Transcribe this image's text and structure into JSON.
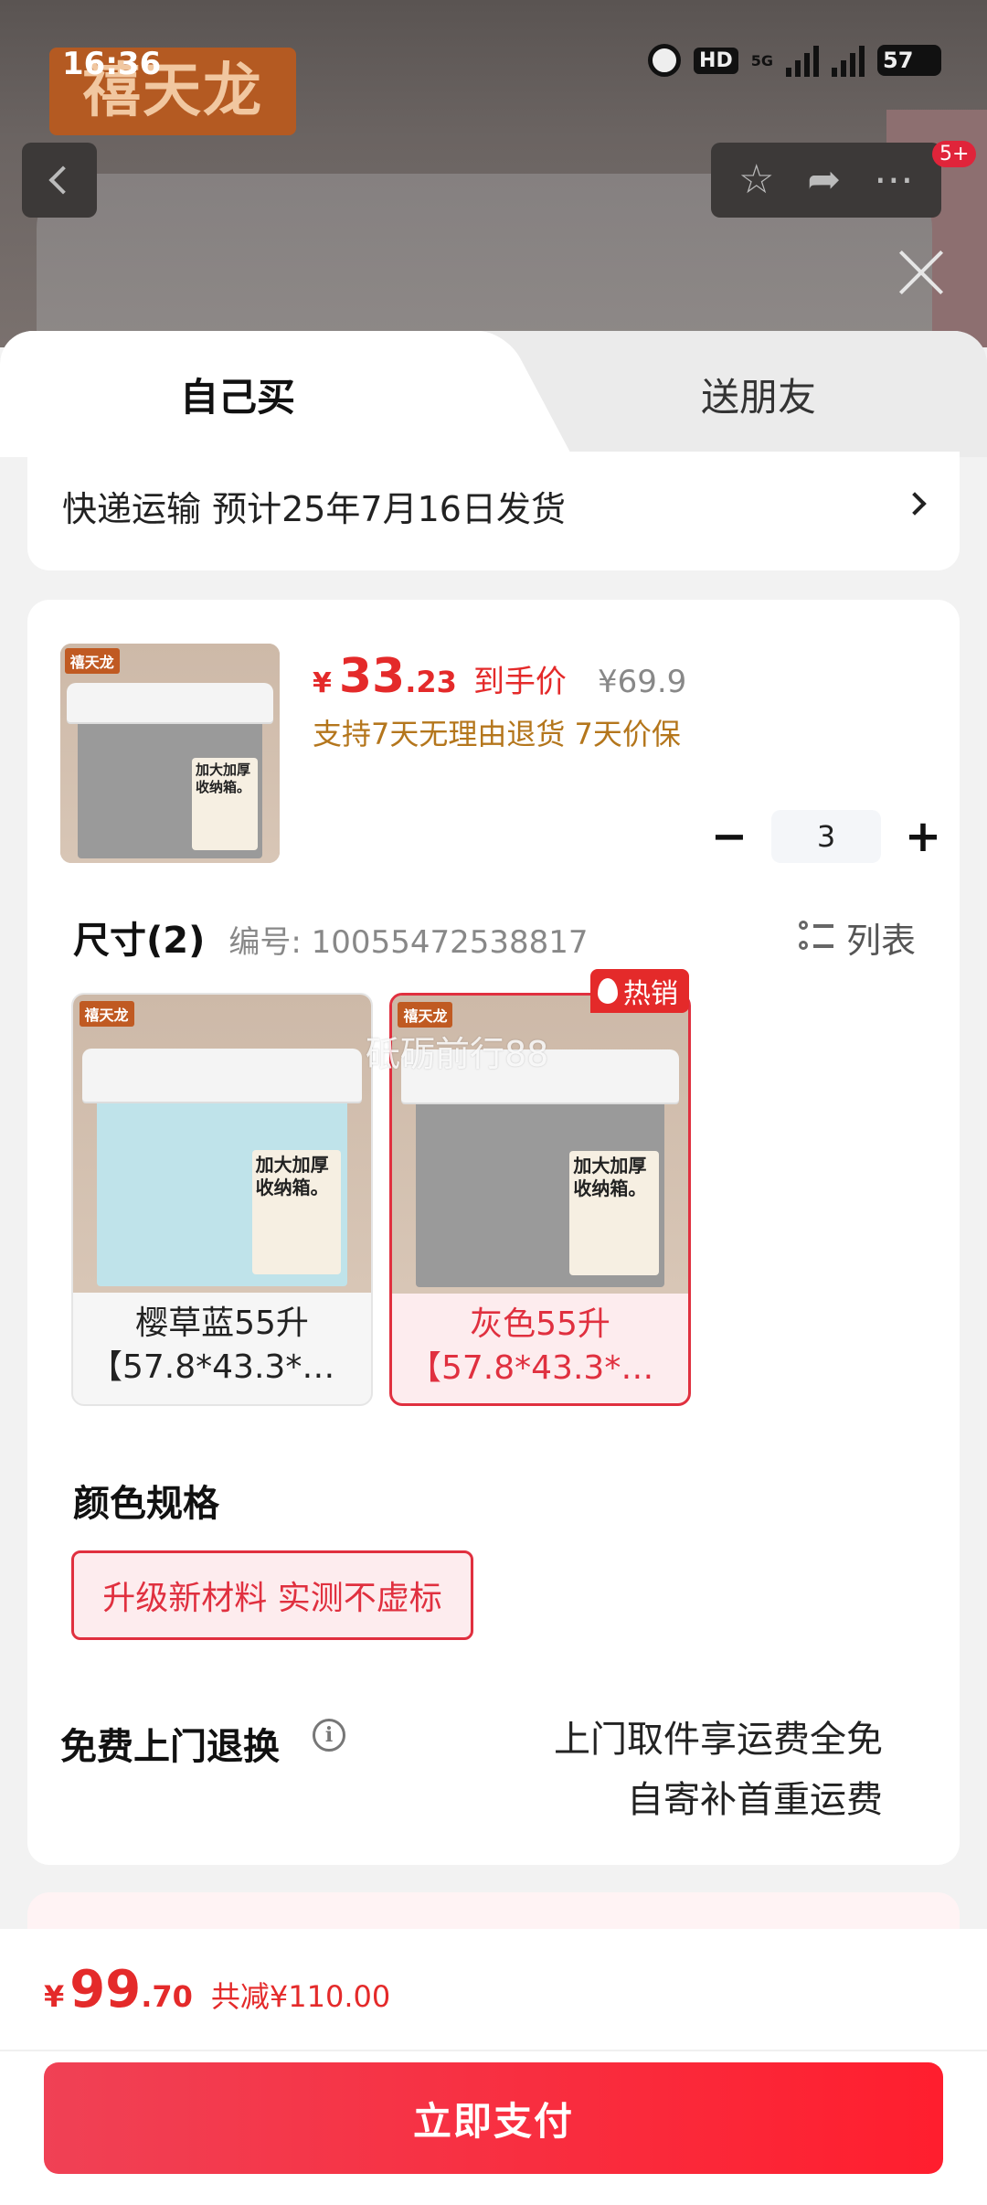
{
  "status_bar": {
    "time": "16:36",
    "hd": "HD",
    "network": "5G",
    "battery": "57"
  },
  "background": {
    "brand_logo_text": "禧天龙",
    "notification_badge": "5+"
  },
  "tabs": [
    {
      "label": "自己买",
      "active": true
    },
    {
      "label": "送朋友",
      "active": false
    }
  ],
  "shipping": {
    "text": "快递运输 预计25年7月16日发货"
  },
  "product": {
    "currency": "¥",
    "price_int": "33",
    "price_dec": ".23",
    "price_tag": "到手价",
    "original_price": "¥69.9",
    "promise": "支持7天无理由退货 7天价保",
    "thumbnail_brand": "禧天龙",
    "thumbnail_caption": "加大加厚收纳箱。"
  },
  "quantity": {
    "value": "3",
    "minus": "−",
    "plus": "+"
  },
  "size_section": {
    "title": "尺寸(2)",
    "code": "编号: 10055472538817",
    "view_toggle": "列表"
  },
  "sku_options": [
    {
      "line1": "樱草蓝55升",
      "line2": "【57.8*43.3*3…",
      "selected": false,
      "box_color": "#bfe3ea",
      "brand": "禧天龙",
      "caption": "加大加厚收纳箱。"
    },
    {
      "line1": "灰色55升",
      "line2": "【57.8*43.3*3…",
      "selected": true,
      "box_color": "#9a9a9a",
      "brand": "禧天龙",
      "caption": "加大加厚收纳箱。"
    }
  ],
  "hot_badge": "热销",
  "watermark": "砥砺前行88",
  "color_section": {
    "title": "颜色规格",
    "option": "升级新材料 实测不虚标"
  },
  "returns": {
    "title": "免费上门退换",
    "info_icon": "i",
    "line1": "上门取件享运费全免",
    "line2": "自寄补首重运费"
  },
  "footer": {
    "currency": "¥",
    "total_int": "99",
    "total_dec": ".70",
    "savings": "共减¥110.00",
    "pay_button": "立即支付"
  },
  "colors": {
    "accent": "#e42a2a",
    "promise": "#b4761c",
    "pay_start": "#f04155",
    "pay_end": "#ff1e2e"
  }
}
